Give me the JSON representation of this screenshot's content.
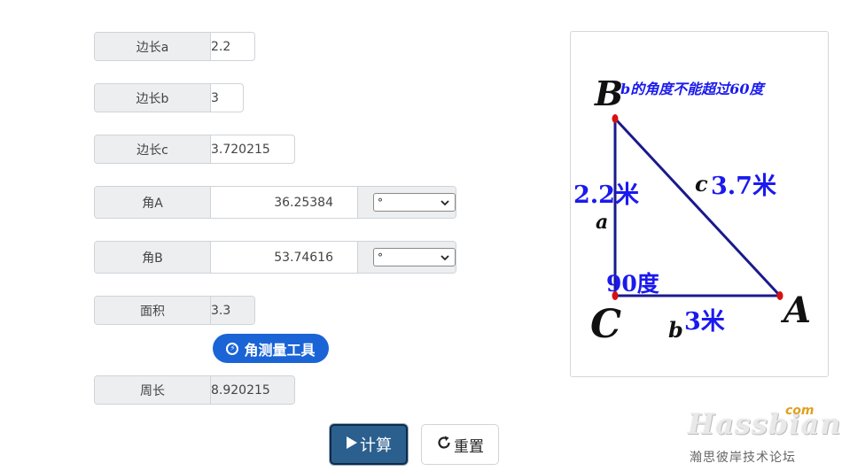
{
  "form": {
    "side_a": {
      "label": "边长a",
      "value": "2.2"
    },
    "side_b": {
      "label": "边长b",
      "value": "3"
    },
    "side_c": {
      "label": "边长c",
      "value": "3.720215"
    },
    "angle_a": {
      "label": "角A",
      "value": "36.25384",
      "unit": "°"
    },
    "angle_b": {
      "label": "角B",
      "value": "53.74616",
      "unit": "°"
    },
    "area": {
      "label": "面积",
      "value": "3.3"
    },
    "angle_tool": {
      "label": "角测量工具"
    },
    "perimeter": {
      "label": "周长",
      "value": "8.920215"
    }
  },
  "buttons": {
    "calc": "计算",
    "reset": "重置"
  },
  "diagram": {
    "vertex_b": "B",
    "vertex_a": "A",
    "vertex_c": "C",
    "note": "b的角度不能超过60度",
    "side_a_value": "2.2米",
    "side_a_letter": "a",
    "side_c_letter": "c",
    "side_c_value": "3.7米",
    "right_angle": "90度",
    "side_b_letter": "b",
    "side_b_value": "3米"
  },
  "watermark": {
    "brand": "Hassbian",
    "tld": "com",
    "subtitle": "瀚思彼岸技术论坛"
  },
  "colors": {
    "primary_button": "#1a64d6",
    "calc_button": "#2b5f8e",
    "triangle": "#1a1a8c",
    "label_blue": "#1a1aee",
    "point_red": "#d81010"
  }
}
